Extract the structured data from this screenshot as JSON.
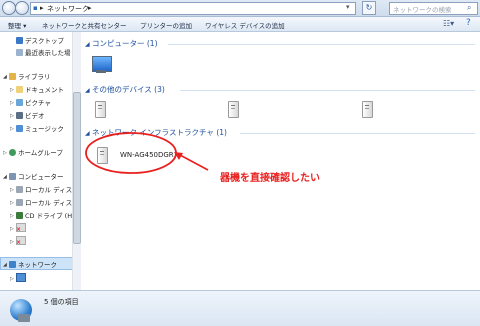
{
  "address": {
    "location": "ネットワーク",
    "separator": "▸",
    "search_placeholder": "ネットワークの検索",
    "refresh_glyph": "↻"
  },
  "toolbar": {
    "organize": "整理 ▾",
    "network_center": "ネットワークと共有センター",
    "add_printer": "プリンターの追加",
    "add_wireless": "ワイヤレス デバイスの追加"
  },
  "sidebar": {
    "items": [
      {
        "label": "デスクトップ"
      },
      {
        "label": "最近表示した場"
      },
      {
        "label": "ライブラリ"
      },
      {
        "label": "ドキュメント"
      },
      {
        "label": "ピクチャ"
      },
      {
        "label": "ビデオ"
      },
      {
        "label": "ミュージック"
      },
      {
        "label": "ホームグループ"
      },
      {
        "label": "コンピューター"
      },
      {
        "label": "ローカル ディス"
      },
      {
        "label": "ローカル ディス"
      },
      {
        "label": "CD ドライブ (H"
      },
      {
        "label": "ネットワーク"
      }
    ]
  },
  "groups": {
    "computers": "コンピューター (1)",
    "other_devices": "その他のデバイス (3)",
    "infrastructure": "ネットワーク インフラストラクチャ (1)"
  },
  "router": {
    "label": "WN-AG450DGR"
  },
  "annotation": {
    "text": "器機を直接確認したい",
    "color": "#e8201e"
  },
  "status": {
    "count": "5 個の項目"
  }
}
